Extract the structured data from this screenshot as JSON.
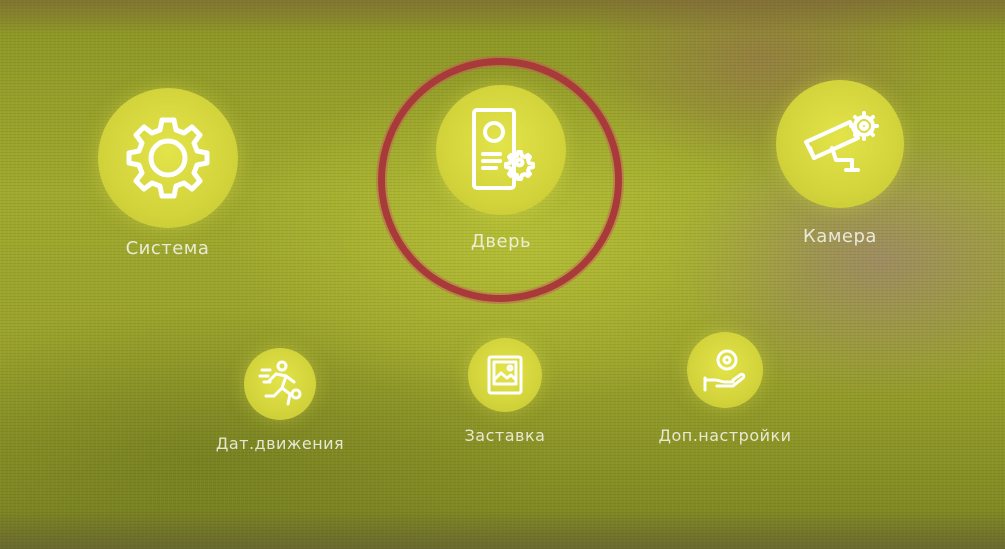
{
  "menu": {
    "items": [
      {
        "label": "Система",
        "icon": "gear-icon"
      },
      {
        "label": "Дверь",
        "icon": "door-phone-settings-icon"
      },
      {
        "label": "Камера",
        "icon": "camera-settings-icon"
      },
      {
        "label": "Дат.движения",
        "icon": "motion-sensor-icon"
      },
      {
        "label": "Заставка",
        "icon": "screensaver-icon"
      },
      {
        "label": "Доп.настройки",
        "icon": "extra-settings-icon"
      }
    ]
  },
  "colors": {
    "icon_circle": "#d6d83d",
    "background": "#9aa22b",
    "highlight_ring": "#a83a3a",
    "icon_stroke": "#ffffff"
  }
}
